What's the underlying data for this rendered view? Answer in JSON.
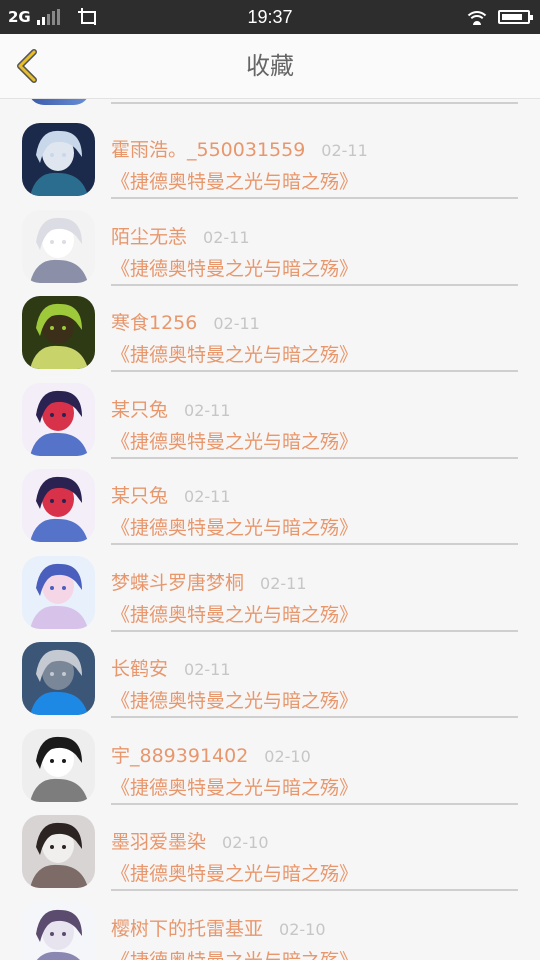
{
  "status_bar": {
    "network": "2G",
    "time": "19:37",
    "battery_level": 0.85
  },
  "header": {
    "title": "收藏",
    "back_icon": "chevron-left-icon",
    "accent_color": "#e8bf2a"
  },
  "colors": {
    "name": "#e8976d",
    "date": "#c6c6c6",
    "divider": "#cfcfcf"
  },
  "items": [
    {
      "user": "霍雨浩。_550031559",
      "date": "02-11",
      "title": "《捷德奥特曼之光与暗之殇》"
    },
    {
      "user": "陌尘无恙",
      "date": "02-11",
      "title": "《捷德奥特曼之光与暗之殇》"
    },
    {
      "user": "寒食1256",
      "date": "02-11",
      "title": "《捷德奥特曼之光与暗之殇》"
    },
    {
      "user": "某只兔",
      "date": "02-11",
      "title": "《捷德奥特曼之光与暗之殇》"
    },
    {
      "user": "某只兔",
      "date": "02-11",
      "title": "《捷德奥特曼之光与暗之殇》"
    },
    {
      "user": "梦蝶斗罗唐梦桐",
      "date": "02-11",
      "title": "《捷德奥特曼之光与暗之殇》"
    },
    {
      "user": "长鹤安",
      "date": "02-11",
      "title": "《捷德奥特曼之光与暗之殇》"
    },
    {
      "user": "宇_889391402",
      "date": "02-10",
      "title": "《捷德奥特曼之光与暗之殇》"
    },
    {
      "user": "墨羽爱墨染",
      "date": "02-10",
      "title": "《捷德奥特曼之光与暗之殇》"
    },
    {
      "user": "樱树下的托雷基亚",
      "date": "02-10",
      "title": "《捷德奥特曼之光与暗之殇》"
    }
  ]
}
